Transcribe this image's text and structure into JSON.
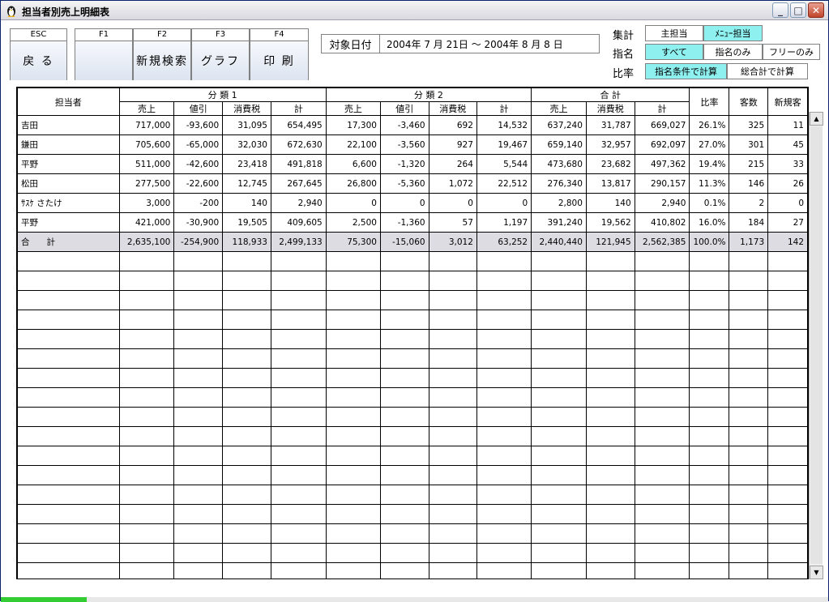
{
  "window": {
    "title": "担当者別売上明細表",
    "min_glyph": "_",
    "max_glyph": "□",
    "close_glyph": "✕"
  },
  "fkeys": [
    {
      "key": "ESC",
      "label": "戻 る"
    },
    {
      "key": "F1",
      "label": ""
    },
    {
      "key": "F2",
      "label": "新規検索"
    },
    {
      "key": "F3",
      "label": "グラフ"
    },
    {
      "key": "F4",
      "label": "印 刷"
    }
  ],
  "date": {
    "label": "対象日付",
    "value": "2004年 7 月 21日 ～ 2004年 8 月 8 日"
  },
  "options": {
    "aggregate_label": "集計",
    "aggregate": [
      "主担当",
      "ﾒﾆｭｰ担当"
    ],
    "nominate_label": "指名",
    "nominate": [
      "すべて",
      "指名のみ",
      "フリーのみ"
    ],
    "ratio_label": "比率",
    "ratio": [
      "指名条件で計算",
      "総合計で計算"
    ]
  },
  "colors": {
    "accent": "#8ff0f0",
    "total_row": "#dcdce2"
  },
  "table": {
    "group_headers": {
      "staff": "担当者",
      "cat1": "分 類 1",
      "cat2": "分 類 2",
      "total": "合 計",
      "ratio": "比率",
      "customers": "客数",
      "new_customers": "新規客"
    },
    "sub_headers": [
      "売上",
      "値引",
      "消費税",
      "計",
      "売上",
      "値引",
      "消費税",
      "計",
      "売上",
      "消費税",
      "計"
    ],
    "rows": [
      [
        "吉田",
        "717,000",
        "-93,600",
        "31,095",
        "654,495",
        "17,300",
        "-3,460",
        "692",
        "14,532",
        "637,240",
        "31,787",
        "669,027",
        "26.1%",
        "325",
        "11"
      ],
      [
        "鎌田",
        "705,600",
        "-65,000",
        "32,030",
        "672,630",
        "22,100",
        "-3,560",
        "927",
        "19,467",
        "659,140",
        "32,957",
        "692,097",
        "27.0%",
        "301",
        "45"
      ],
      [
        "平野",
        "511,000",
        "-42,600",
        "23,418",
        "491,818",
        "6,600",
        "-1,320",
        "264",
        "5,544",
        "473,680",
        "23,682",
        "497,362",
        "19.4%",
        "215",
        "33"
      ],
      [
        "松田",
        "277,500",
        "-22,600",
        "12,745",
        "267,645",
        "26,800",
        "-5,360",
        "1,072",
        "22,512",
        "276,340",
        "13,817",
        "290,157",
        "11.3%",
        "146",
        "26"
      ],
      [
        "ｻｽｹ さたけ",
        "3,000",
        "-200",
        "140",
        "2,940",
        "0",
        "0",
        "0",
        "0",
        "2,800",
        "140",
        "2,940",
        "0.1%",
        "2",
        "0"
      ],
      [
        "平野",
        "421,000",
        "-30,900",
        "19,505",
        "409,605",
        "2,500",
        "-1,360",
        "57",
        "1,197",
        "391,240",
        "19,562",
        "410,802",
        "16.0%",
        "184",
        "27"
      ]
    ],
    "total_row": [
      "合　　計",
      "2,635,100",
      "-254,900",
      "118,933",
      "2,499,133",
      "75,300",
      "-15,060",
      "3,012",
      "63,252",
      "2,440,440",
      "121,945",
      "2,562,385",
      "100.0%",
      "1,173",
      "142"
    ],
    "empty_rows": 17
  }
}
